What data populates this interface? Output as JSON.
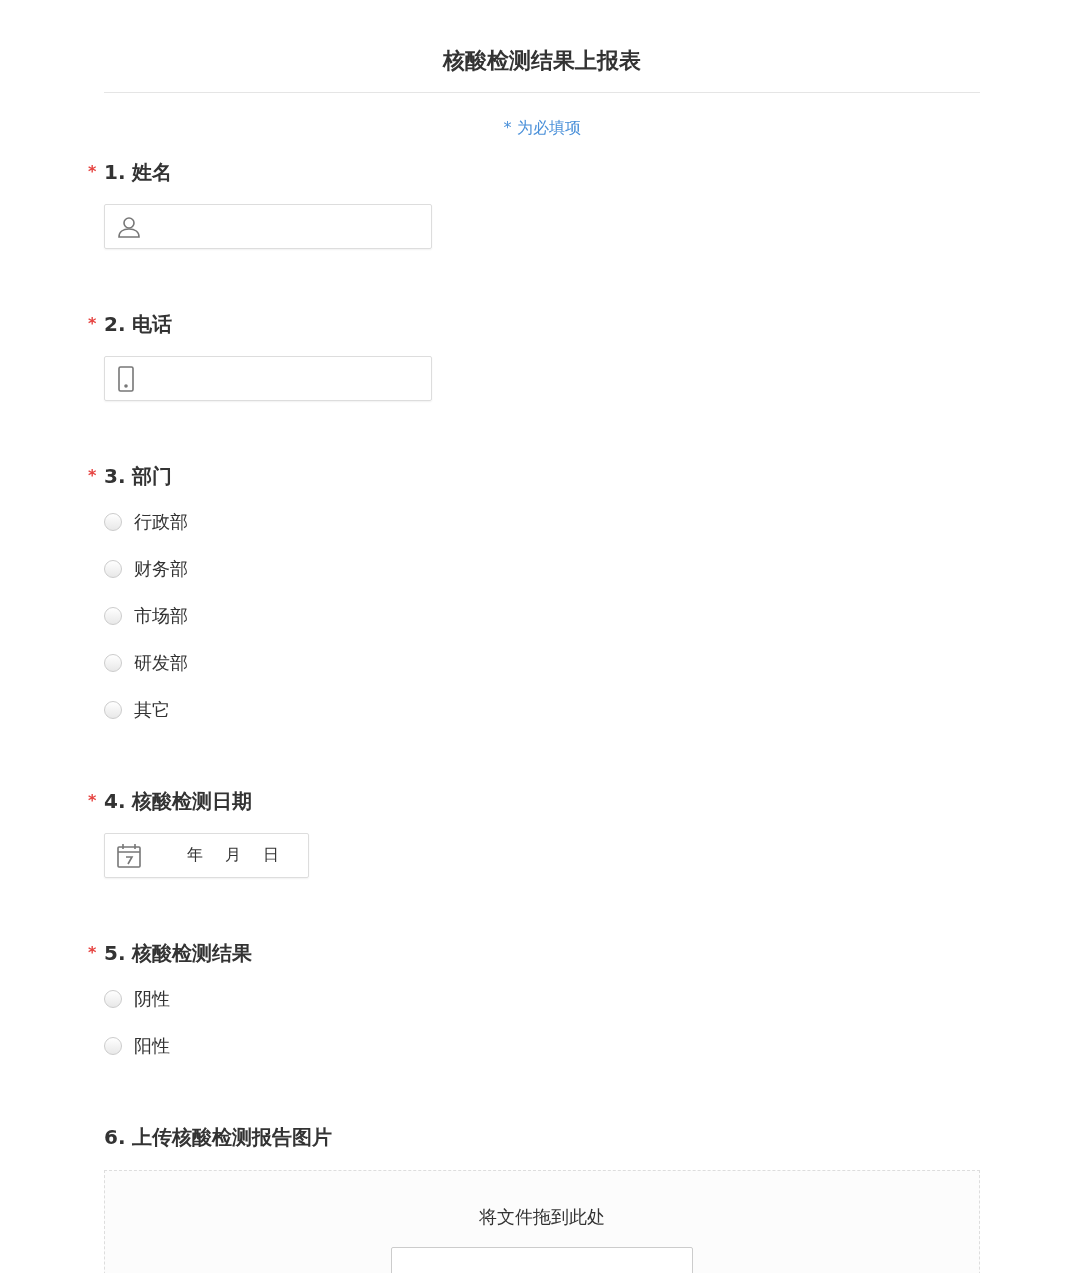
{
  "title": "核酸检测结果上报表",
  "required_note": "* 为必填项",
  "required_mark": "*",
  "questions": [
    {
      "kind": "name",
      "number": "1.",
      "label": "姓名",
      "required": true
    },
    {
      "kind": "phone",
      "number": "2.",
      "label": "电话",
      "required": true
    },
    {
      "kind": "choice",
      "number": "3.",
      "label": "部门",
      "required": true,
      "options": [
        {
          "label": "行政部",
          "selected": false
        },
        {
          "label": "财务部",
          "selected": false
        },
        {
          "label": "市场部",
          "selected": false
        },
        {
          "label": "研发部",
          "selected": false
        },
        {
          "label": "其它",
          "selected": false
        }
      ]
    },
    {
      "kind": "date",
      "number": "4.",
      "label": "核酸检测日期",
      "required": true,
      "parts": [
        "年",
        "月",
        "日"
      ]
    },
    {
      "kind": "choice",
      "number": "5.",
      "label": "核酸检测结果",
      "required": true,
      "options": [
        {
          "label": "阴性",
          "selected": false
        },
        {
          "label": "阳性",
          "selected": false
        }
      ]
    },
    {
      "kind": "upload",
      "number": "6.",
      "label": "上传核酸检测报告图片",
      "required": false,
      "drop_text": "将文件拖到此处"
    }
  ]
}
